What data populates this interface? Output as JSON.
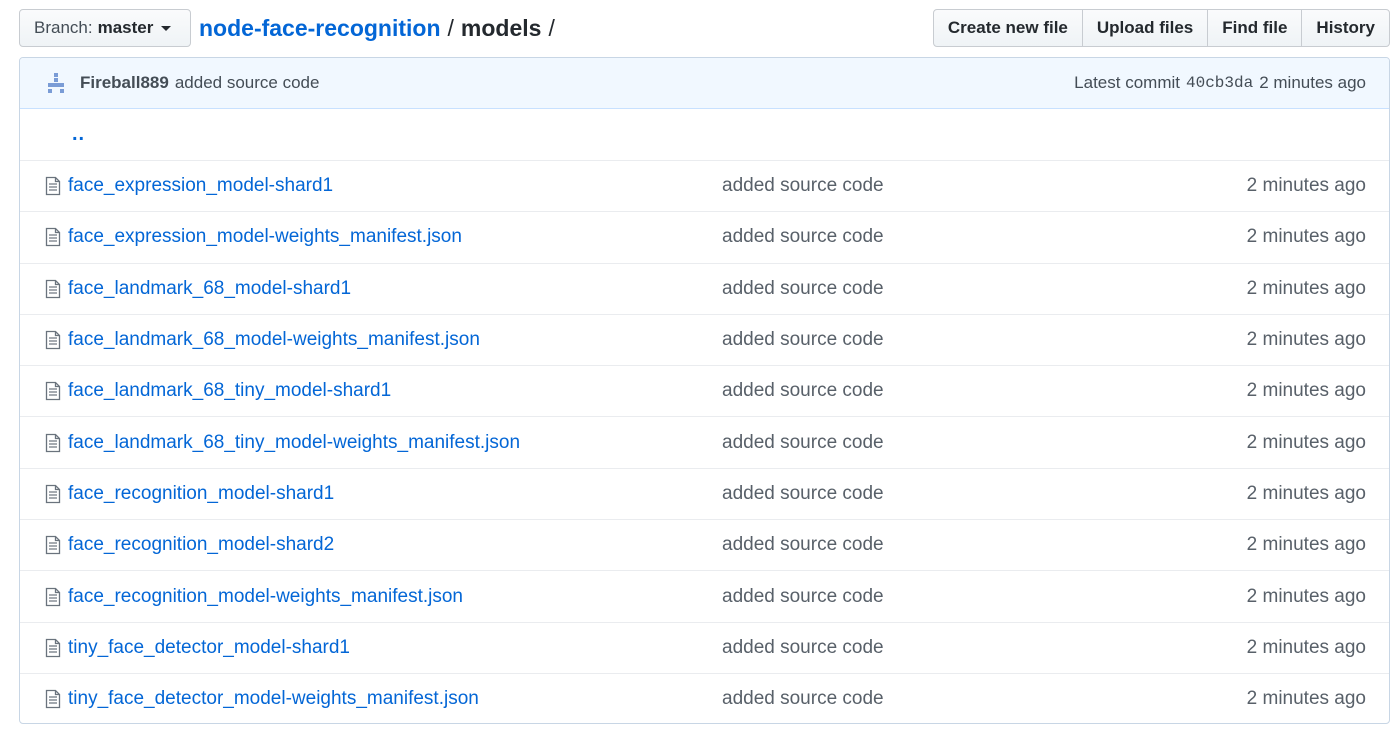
{
  "branch": {
    "label": "Branch:",
    "value": "master"
  },
  "breadcrumb": {
    "repo": "node-face-recognition",
    "separator": "/",
    "folder": "models",
    "trailing": "/"
  },
  "actions": {
    "create_new_file": "Create new file",
    "upload_files": "Upload files",
    "find_file": "Find file",
    "history": "History"
  },
  "commit": {
    "author": "Fireball889",
    "message": "added source code",
    "latest_label": "Latest commit",
    "sha": "40cb3da",
    "age": "2 minutes ago"
  },
  "parent_link": "..",
  "files": [
    {
      "name": "face_expression_model-shard1",
      "message": "added source code",
      "age": "2 minutes ago"
    },
    {
      "name": "face_expression_model-weights_manifest.json",
      "message": "added source code",
      "age": "2 minutes ago"
    },
    {
      "name": "face_landmark_68_model-shard1",
      "message": "added source code",
      "age": "2 minutes ago"
    },
    {
      "name": "face_landmark_68_model-weights_manifest.json",
      "message": "added source code",
      "age": "2 minutes ago"
    },
    {
      "name": "face_landmark_68_tiny_model-shard1",
      "message": "added source code",
      "age": "2 minutes ago"
    },
    {
      "name": "face_landmark_68_tiny_model-weights_manifest.json",
      "message": "added source code",
      "age": "2 minutes ago"
    },
    {
      "name": "face_recognition_model-shard1",
      "message": "added source code",
      "age": "2 minutes ago"
    },
    {
      "name": "face_recognition_model-shard2",
      "message": "added source code",
      "age": "2 minutes ago"
    },
    {
      "name": "face_recognition_model-weights_manifest.json",
      "message": "added source code",
      "age": "2 minutes ago"
    },
    {
      "name": "tiny_face_detector_model-shard1",
      "message": "added source code",
      "age": "2 minutes ago"
    },
    {
      "name": "tiny_face_detector_model-weights_manifest.json",
      "message": "added source code",
      "age": "2 minutes ago"
    }
  ],
  "colors": {
    "link": "#0366d6",
    "commit_bar": "#f1f8ff",
    "muted": "#586069"
  }
}
